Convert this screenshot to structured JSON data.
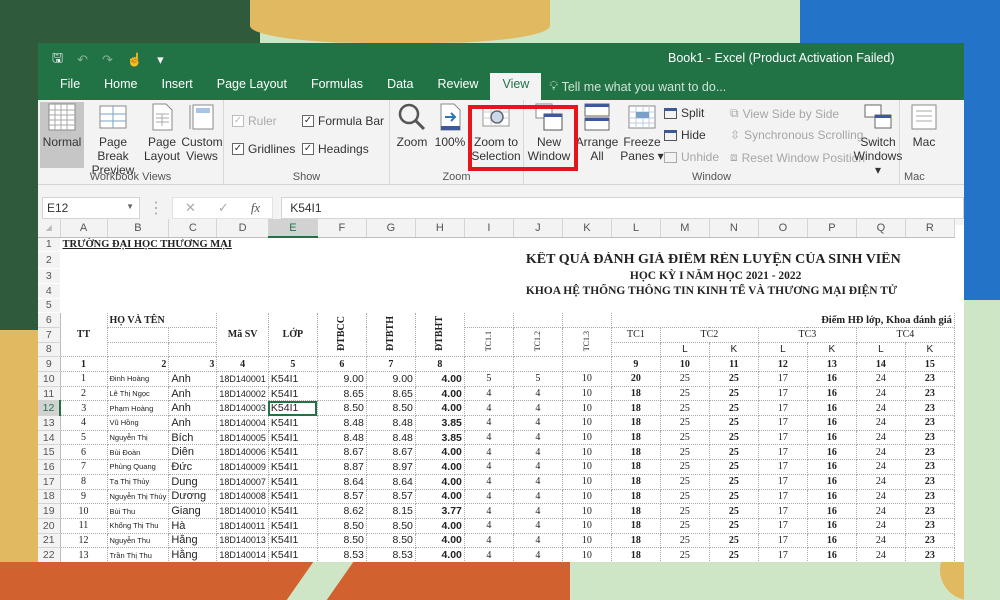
{
  "window": {
    "title": "Book1 - Excel (Product Activation Failed)"
  },
  "quick_access": [
    {
      "icon": "save-icon",
      "glyph": "🖫"
    },
    {
      "icon": "undo-icon",
      "glyph": "↶"
    },
    {
      "icon": "redo-icon",
      "glyph": "↷"
    },
    {
      "icon": "touch-mode-icon",
      "glyph": "☝"
    },
    {
      "icon": "customize-qat-icon",
      "glyph": "▾"
    }
  ],
  "tabs": [
    "File",
    "Home",
    "Insert",
    "Page Layout",
    "Formulas",
    "Data",
    "Review",
    "View"
  ],
  "active_tab": "View",
  "tell_me": {
    "placeholder": "Tell me what you want to do..."
  },
  "ribbon": {
    "workbook_views": {
      "label": "Workbook Views",
      "normal": "Normal",
      "page_break_1": "Page Break",
      "page_break_2": "Preview",
      "page_layout_1": "Page",
      "page_layout_2": "Layout",
      "custom_views_1": "Custom",
      "custom_views_2": "Views"
    },
    "show": {
      "label": "Show",
      "ruler": "Ruler",
      "formula_bar": "Formula Bar",
      "gridlines": "Gridlines",
      "headings": "Headings",
      "ruler_checked": true,
      "formula_bar_checked": true,
      "gridlines_checked": true,
      "headings_checked": true
    },
    "zoom": {
      "label": "Zoom",
      "zoom": "Zoom",
      "hundred": "100%",
      "zoom_sel_1": "Zoom to",
      "zoom_sel_2": "Selection"
    },
    "window": {
      "label": "Window",
      "new_window_1": "New",
      "new_window_2": "Window",
      "arrange_1": "Arrange",
      "arrange_2": "All",
      "freeze_1": "Freeze",
      "freeze_2": "Panes",
      "split": "Split",
      "hide": "Hide",
      "unhide": "Unhide",
      "side_by_side": "View Side by Side",
      "sync_scroll": "Synchronous Scrolling",
      "reset_pos": "Reset Window Position",
      "switch_1": "Switch",
      "switch_2": "Windows"
    },
    "macros": {
      "label": "Mac",
      "btn": "Mac"
    }
  },
  "formula_bar": {
    "name_box": "E12",
    "cancel": "✕",
    "enter": "✓",
    "fx": "fx",
    "value": "K54I1"
  },
  "columns": [
    "A",
    "B",
    "C",
    "D",
    "E",
    "F",
    "G",
    "H",
    "I",
    "J",
    "K",
    "L",
    "M",
    "N",
    "O",
    "P",
    "Q",
    "R"
  ],
  "selected_column": "E",
  "selected_row": 12,
  "sheet": {
    "school": "TRƯỜNG ĐẠI HỌC THƯƠNG MẠI",
    "title1": "KẾT QUẢ ĐÁNH GIÁ ĐIỂM RÈN LUYỆN CỦA SINH VIÊN",
    "title2": "HỌC KỲ I NĂM HỌC 2021 - 2022",
    "title3": "KHOA HỆ THỐNG THÔNG TIN KINH TẾ VÀ THƯƠNG MẠI ĐIỆN TỬ",
    "hdr": {
      "tt": "TT",
      "ho_ten": "HỌ VÀ TÊN",
      "ma_sv": "Mã SV",
      "lop": "LỚP",
      "dtbcc": "ĐTBCC",
      "dtbth": "ĐTBTH",
      "dtbht": "ĐTBHT",
      "tc11": "TC1.1",
      "tc12": "TC1.2",
      "tc13": "TC1.3",
      "group": "Điểm HĐ lớp, Khoa đánh giá",
      "tc1": "TC1",
      "tc2": "TC2",
      "tc3": "TC3",
      "tc4": "TC4",
      "l": "L",
      "k": "K"
    },
    "index_row": [
      "1",
      "2",
      "3",
      "4",
      "5",
      "6",
      "7",
      "8",
      "",
      "",
      "",
      "9",
      "10",
      "11",
      "12",
      "13",
      "14",
      "15"
    ],
    "rows": [
      {
        "r": 10,
        "tt": "1",
        "ho": "Đinh Hoàng",
        "ten": "Anh",
        "ma": "18D140001",
        "lop": "K54I1",
        "f": "9.00",
        "g": "9.00",
        "h": "4.00",
        "i": "5",
        "j": "5",
        "k": "10",
        "l": "20",
        "m": "25",
        "n": "25",
        "o": "17",
        "p": "16",
        "q": "24",
        "rr": "23"
      },
      {
        "r": 11,
        "tt": "2",
        "ho": "Lê Thị Ngọc",
        "ten": "Anh",
        "ma": "18D140002",
        "lop": "K54I1",
        "f": "8.65",
        "g": "8.65",
        "h": "4.00",
        "i": "4",
        "j": "4",
        "k": "10",
        "l": "18",
        "m": "25",
        "n": "25",
        "o": "17",
        "p": "16",
        "q": "24",
        "rr": "23"
      },
      {
        "r": 12,
        "tt": "3",
        "ho": "Phạm Hoàng",
        "ten": "Anh",
        "ma": "18D140003",
        "lop": "K54I1",
        "f": "8.50",
        "g": "8.50",
        "h": "4.00",
        "i": "4",
        "j": "4",
        "k": "10",
        "l": "18",
        "m": "25",
        "n": "25",
        "o": "17",
        "p": "16",
        "q": "24",
        "rr": "23"
      },
      {
        "r": 13,
        "tt": "4",
        "ho": "Vũ Hồng",
        "ten": "Anh",
        "ma": "18D140004",
        "lop": "K54I1",
        "f": "8.48",
        "g": "8.48",
        "h": "3.85",
        "i": "4",
        "j": "4",
        "k": "10",
        "l": "18",
        "m": "25",
        "n": "25",
        "o": "17",
        "p": "16",
        "q": "24",
        "rr": "23"
      },
      {
        "r": 14,
        "tt": "5",
        "ho": "Nguyễn Thị",
        "ten": "Bích",
        "ma": "18D140005",
        "lop": "K54I1",
        "f": "8.48",
        "g": "8.48",
        "h": "3.85",
        "i": "4",
        "j": "4",
        "k": "10",
        "l": "18",
        "m": "25",
        "n": "25",
        "o": "17",
        "p": "16",
        "q": "24",
        "rr": "23"
      },
      {
        "r": 15,
        "tt": "6",
        "ho": "Bùi Đoàn",
        "ten": "Diên",
        "ma": "18D140006",
        "lop": "K54I1",
        "f": "8.67",
        "g": "8.67",
        "h": "4.00",
        "i": "4",
        "j": "4",
        "k": "10",
        "l": "18",
        "m": "25",
        "n": "25",
        "o": "17",
        "p": "16",
        "q": "24",
        "rr": "23"
      },
      {
        "r": 16,
        "tt": "7",
        "ho": "Phùng Quang",
        "ten": "Đức",
        "ma": "18D140009",
        "lop": "K54I1",
        "f": "8.87",
        "g": "8.97",
        "h": "4.00",
        "i": "4",
        "j": "4",
        "k": "10",
        "l": "18",
        "m": "25",
        "n": "25",
        "o": "17",
        "p": "16",
        "q": "24",
        "rr": "23"
      },
      {
        "r": 17,
        "tt": "8",
        "ho": "Tạ Thị Thủy",
        "ten": "Dung",
        "ma": "18D140007",
        "lop": "K54I1",
        "f": "8.64",
        "g": "8.64",
        "h": "4.00",
        "i": "4",
        "j": "4",
        "k": "10",
        "l": "18",
        "m": "25",
        "n": "25",
        "o": "17",
        "p": "16",
        "q": "24",
        "rr": "23"
      },
      {
        "r": 18,
        "tt": "9",
        "ho": "Nguyễn Thị Thùy",
        "ten": "Dương",
        "ma": "18D140008",
        "lop": "K54I1",
        "f": "8.57",
        "g": "8.57",
        "h": "4.00",
        "i": "4",
        "j": "4",
        "k": "10",
        "l": "18",
        "m": "25",
        "n": "25",
        "o": "17",
        "p": "16",
        "q": "24",
        "rr": "23"
      },
      {
        "r": 19,
        "tt": "10",
        "ho": "Bùi Thu",
        "ten": "Giang",
        "ma": "18D140010",
        "lop": "K54I1",
        "f": "8.62",
        "g": "8.15",
        "h": "3.77",
        "i": "4",
        "j": "4",
        "k": "10",
        "l": "18",
        "m": "25",
        "n": "25",
        "o": "17",
        "p": "16",
        "q": "24",
        "rr": "23"
      },
      {
        "r": 20,
        "tt": "11",
        "ho": "Khổng Thị Thu",
        "ten": "Hà",
        "ma": "18D140011",
        "lop": "K54I1",
        "f": "8.50",
        "g": "8.50",
        "h": "4.00",
        "i": "4",
        "j": "4",
        "k": "10",
        "l": "18",
        "m": "25",
        "n": "25",
        "o": "17",
        "p": "16",
        "q": "24",
        "rr": "23"
      },
      {
        "r": 21,
        "tt": "12",
        "ho": "Nguyễn Thu",
        "ten": "Hằng",
        "ma": "18D140013",
        "lop": "K54I1",
        "f": "8.50",
        "g": "8.50",
        "h": "4.00",
        "i": "4",
        "j": "4",
        "k": "10",
        "l": "18",
        "m": "25",
        "n": "25",
        "o": "17",
        "p": "16",
        "q": "24",
        "rr": "23"
      },
      {
        "r": 22,
        "tt": "13",
        "ho": "Trần Thị Thu",
        "ten": "Hằng",
        "ma": "18D140014",
        "lop": "K54I1",
        "f": "8.53",
        "g": "8.53",
        "h": "4.00",
        "i": "4",
        "j": "4",
        "k": "10",
        "l": "18",
        "m": "25",
        "n": "25",
        "o": "17",
        "p": "16",
        "q": "24",
        "rr": "23"
      }
    ]
  },
  "colors": {
    "excel_green": "#217346",
    "highlight_red": "#e8141b"
  }
}
